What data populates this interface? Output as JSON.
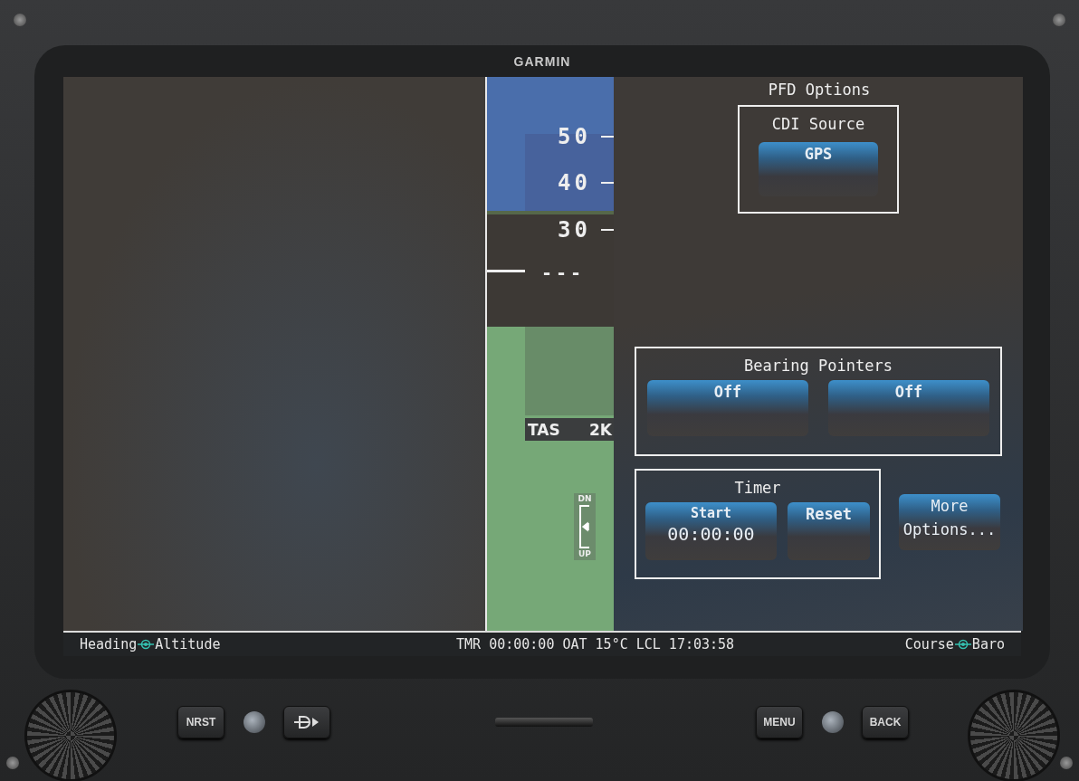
{
  "device": {
    "brand": "GARMIN"
  },
  "altitude_tape": {
    "labels": [
      "50",
      "40",
      "30"
    ],
    "readout": "---",
    "tas_label": "TAS",
    "tas_value": "2K",
    "trim_top": "DN",
    "trim_bottom": "UP"
  },
  "options": {
    "title": "PFD Options",
    "cdi": {
      "title": "CDI Source",
      "button": "GPS"
    },
    "bearing": {
      "title": "Bearing Pointers",
      "buttons": [
        "Off",
        "Off"
      ]
    },
    "timer": {
      "title": "Timer",
      "start_label": "Start",
      "start_value": "00:00:00",
      "reset_label": "Reset"
    },
    "more_button": "More Options..."
  },
  "status_bar": {
    "left": [
      "Heading",
      "Altitude"
    ],
    "center": "TMR 00:00:00 OAT 15°C LCL 17:03:58",
    "right": [
      "Course",
      "Baro"
    ]
  },
  "keys_left": [
    "NRST"
  ],
  "keys_right": [
    "MENU",
    "BACK"
  ]
}
